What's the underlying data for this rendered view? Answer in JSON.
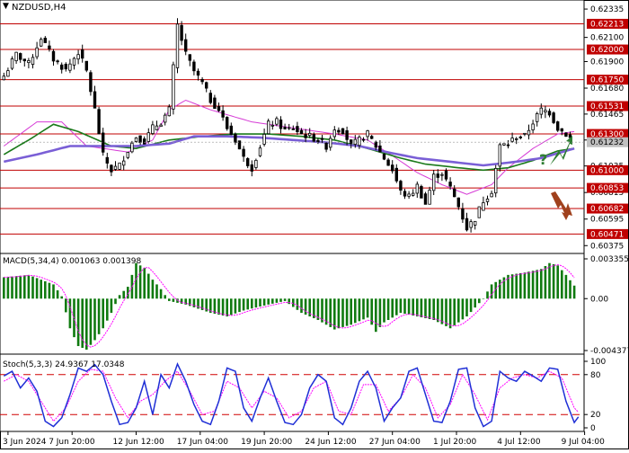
{
  "window": {
    "symbol_timeframe": "NZDUSD,H4",
    "dropdown_glyph": "▼"
  },
  "colors": {
    "candle": "#000000",
    "resistance_line": "#c00000",
    "ma_fast": "#d63bd6",
    "ma_mid": "#1a7a1a",
    "ma_slow": "#7a5fd6",
    "macd_hist": "#0f7a0f",
    "macd_signal": "#ff00ff",
    "stoch_main": "#1f2fd6",
    "stoch_signal": "#ff00ff",
    "stoch_level": "#d00000",
    "current_price_box": "#c0c0c0",
    "up_arrow": "#2e7d32",
    "down_arrow": "#a0411d",
    "question_mark": "#2e7d32"
  },
  "price_axis": {
    "ticks": [
      "0.62335",
      "0.62100",
      "0.61900",
      "0.61680",
      "0.61465",
      "0.61250",
      "0.61035",
      "0.60815",
      "0.60595",
      "0.60375"
    ],
    "levels": [
      {
        "label": "0.62213",
        "value": 0.62213
      },
      {
        "label": "0.62000",
        "value": 0.62
      },
      {
        "label": "0.61750",
        "value": 0.6175
      },
      {
        "label": "0.61531",
        "value": 0.61531
      },
      {
        "label": "0.61300",
        "value": 0.613
      },
      {
        "label": "0.61000",
        "value": 0.61
      },
      {
        "label": "0.60853",
        "value": 0.60853
      },
      {
        "label": "0.60682",
        "value": 0.60682
      },
      {
        "label": "0.60471",
        "value": 0.60471
      }
    ],
    "current_price": "0.61232",
    "range": [
      0.6031,
      0.6241
    ]
  },
  "annotations": {
    "question": "?",
    "up_arrow_icon": "up-arrow-icon",
    "down_arrow_icon": "down-arrow-icon"
  },
  "macd": {
    "label": "MACD(5,34,4) 0.001063 0.001398",
    "ticks": [
      "0.003355",
      "0.00",
      "-0.004377"
    ]
  },
  "stochastic": {
    "label": "Stoch(5,3,3) 24.9367 17.0348",
    "ticks": [
      "100",
      "80",
      "20",
      "0"
    ],
    "levels": [
      80,
      20
    ]
  },
  "time_axis": {
    "labels": [
      "3 Jun 2024",
      "7 Jun 20:00",
      "12 Jun 12:00",
      "17 Jun 04:00",
      "19 Jun 20:00",
      "24 Jun 12:00",
      "27 Jun 04:00",
      "1 Jul 20:00",
      "4 Jul 12:00",
      "9 Jul 04:00"
    ]
  },
  "chart_data": {
    "type": "candlestick",
    "symbol": "NZDUSD",
    "timeframe": "H4",
    "anchors": [
      [
        0,
        0.6178
      ],
      [
        3,
        0.6196
      ],
      [
        6,
        0.6188
      ],
      [
        9,
        0.621
      ],
      [
        12,
        0.6192
      ],
      [
        15,
        0.6183
      ],
      [
        18,
        0.6198
      ],
      [
        20,
        0.6182
      ],
      [
        22,
        0.615
      ],
      [
        24,
        0.6112
      ],
      [
        26,
        0.61
      ],
      [
        28,
        0.6104
      ],
      [
        30,
        0.6117
      ],
      [
        32,
        0.6128
      ],
      [
        34,
        0.6124
      ],
      [
        36,
        0.6135
      ],
      [
        38,
        0.614
      ],
      [
        40,
        0.615
      ],
      [
        42,
        0.622
      ],
      [
        44,
        0.6196
      ],
      [
        46,
        0.6182
      ],
      [
        48,
        0.6172
      ],
      [
        50,
        0.6158
      ],
      [
        52,
        0.615
      ],
      [
        54,
        0.6135
      ],
      [
        56,
        0.6125
      ],
      [
        58,
        0.611
      ],
      [
        60,
        0.6102
      ],
      [
        62,
        0.612
      ],
      [
        64,
        0.6138
      ],
      [
        66,
        0.614
      ],
      [
        68,
        0.6133
      ],
      [
        70,
        0.6135
      ],
      [
        72,
        0.613
      ],
      [
        74,
        0.6128
      ],
      [
        76,
        0.6125
      ],
      [
        78,
        0.612
      ],
      [
        80,
        0.6135
      ],
      [
        82,
        0.6133
      ],
      [
        84,
        0.612
      ],
      [
        86,
        0.6125
      ],
      [
        88,
        0.613
      ],
      [
        90,
        0.612
      ],
      [
        92,
        0.611
      ],
      [
        94,
        0.61
      ],
      [
        96,
        0.6082
      ],
      [
        98,
        0.6078
      ],
      [
        100,
        0.6087
      ],
      [
        102,
        0.6072
      ],
      [
        104,
        0.6095
      ],
      [
        106,
        0.6098
      ],
      [
        108,
        0.6085
      ],
      [
        110,
        0.607
      ],
      [
        112,
        0.6052
      ],
      [
        114,
        0.606
      ],
      [
        116,
        0.6075
      ],
      [
        118,
        0.6083
      ],
      [
        120,
        0.612
      ],
      [
        122,
        0.6122
      ],
      [
        124,
        0.6128
      ],
      [
        126,
        0.6128
      ],
      [
        128,
        0.614
      ],
      [
        130,
        0.615
      ],
      [
        132,
        0.6148
      ],
      [
        134,
        0.6135
      ],
      [
        136,
        0.613
      ],
      [
        138,
        0.6123
      ]
    ],
    "last_close": 0.61232,
    "resistance_levels": [
      0.62213,
      0.62,
      0.6175,
      0.61531,
      0.613
    ],
    "support_levels": [
      0.61,
      0.60853,
      0.60682,
      0.60471
    ],
    "moving_averages": [
      {
        "anchors": [
          [
            0,
            0.612
          ],
          [
            8,
            0.614
          ],
          [
            14,
            0.614
          ],
          [
            20,
            0.612
          ],
          [
            30,
            0.6115
          ],
          [
            36,
            0.6125
          ],
          [
            40,
            0.615
          ],
          [
            44,
            0.6158
          ],
          [
            50,
            0.615
          ],
          [
            60,
            0.614
          ],
          [
            70,
            0.6135
          ],
          [
            80,
            0.613
          ],
          [
            88,
            0.6125
          ],
          [
            94,
            0.6112
          ],
          [
            100,
            0.6098
          ],
          [
            106,
            0.6088
          ],
          [
            112,
            0.608
          ],
          [
            118,
            0.6088
          ],
          [
            122,
            0.6102
          ],
          [
            128,
            0.6118
          ],
          [
            134,
            0.613
          ],
          [
            138,
            0.6132
          ]
        ]
      },
      {
        "anchors": [
          [
            0,
            0.6113
          ],
          [
            6,
            0.6125
          ],
          [
            12,
            0.6138
          ],
          [
            18,
            0.6132
          ],
          [
            26,
            0.612
          ],
          [
            32,
            0.6118
          ],
          [
            40,
            0.6125
          ],
          [
            48,
            0.6128
          ],
          [
            56,
            0.613
          ],
          [
            64,
            0.613
          ],
          [
            72,
            0.6128
          ],
          [
            80,
            0.6125
          ],
          [
            88,
            0.6118
          ],
          [
            96,
            0.611
          ],
          [
            102,
            0.6105
          ],
          [
            110,
            0.6102
          ],
          [
            116,
            0.61
          ],
          [
            122,
            0.6102
          ],
          [
            128,
            0.6108
          ],
          [
            134,
            0.6116
          ],
          [
            138,
            0.6118
          ]
        ]
      },
      {
        "anchors": [
          [
            0,
            0.6107
          ],
          [
            8,
            0.6113
          ],
          [
            16,
            0.612
          ],
          [
            24,
            0.612
          ],
          [
            32,
            0.612
          ],
          [
            40,
            0.6122
          ],
          [
            46,
            0.6128
          ],
          [
            54,
            0.6128
          ],
          [
            62,
            0.6127
          ],
          [
            70,
            0.6125
          ],
          [
            78,
            0.6123
          ],
          [
            86,
            0.612
          ],
          [
            94,
            0.6114
          ],
          [
            100,
            0.611
          ],
          [
            108,
            0.6107
          ],
          [
            116,
            0.6104
          ],
          [
            124,
            0.6107
          ],
          [
            130,
            0.611
          ],
          [
            138,
            0.6118
          ]
        ]
      }
    ],
    "macd": {
      "range": [
        -0.004377,
        0.003355
      ],
      "anchors": [
        [
          0,
          0.0018
        ],
        [
          6,
          0.002
        ],
        [
          12,
          0.0012
        ],
        [
          14,
          0.0002
        ],
        [
          16,
          -0.0025
        ],
        [
          18,
          -0.004
        ],
        [
          20,
          -0.0043
        ],
        [
          22,
          -0.0035
        ],
        [
          24,
          -0.0025
        ],
        [
          26,
          -0.0012
        ],
        [
          28,
          0.0003
        ],
        [
          30,
          0.001
        ],
        [
          32,
          0.003
        ],
        [
          34,
          0.0026
        ],
        [
          36,
          0.0016
        ],
        [
          38,
          0.0008
        ],
        [
          40,
          -0.0002
        ],
        [
          44,
          -0.0005
        ],
        [
          50,
          -0.0012
        ],
        [
          54,
          -0.0015
        ],
        [
          58,
          -0.001
        ],
        [
          64,
          -0.0005
        ],
        [
          68,
          -0.0002
        ],
        [
          72,
          -0.0012
        ],
        [
          76,
          -0.0018
        ],
        [
          80,
          -0.0026
        ],
        [
          84,
          -0.0022
        ],
        [
          88,
          -0.0016
        ],
        [
          90,
          -0.0028
        ],
        [
          92,
          -0.002
        ],
        [
          96,
          -0.0012
        ],
        [
          100,
          -0.0015
        ],
        [
          104,
          -0.0018
        ],
        [
          108,
          -0.0025
        ],
        [
          112,
          -0.0015
        ],
        [
          116,
          0.0
        ],
        [
          118,
          0.0012
        ],
        [
          122,
          0.002
        ],
        [
          126,
          0.0022
        ],
        [
          130,
          0.0025
        ],
        [
          132,
          0.003
        ],
        [
          134,
          0.0028
        ],
        [
          136,
          0.002
        ],
        [
          138,
          0.0011
        ]
      ]
    },
    "stochastic": {
      "main_anchors": [
        [
          0,
          78
        ],
        [
          2,
          85
        ],
        [
          4,
          60
        ],
        [
          6,
          75
        ],
        [
          8,
          55
        ],
        [
          10,
          10
        ],
        [
          12,
          2
        ],
        [
          14,
          15
        ],
        [
          16,
          50
        ],
        [
          18,
          90
        ],
        [
          20,
          85
        ],
        [
          22,
          95
        ],
        [
          24,
          80
        ],
        [
          26,
          40
        ],
        [
          28,
          5
        ],
        [
          30,
          8
        ],
        [
          32,
          30
        ],
        [
          34,
          70
        ],
        [
          36,
          20
        ],
        [
          38,
          80
        ],
        [
          40,
          60
        ],
        [
          42,
          96
        ],
        [
          44,
          70
        ],
        [
          46,
          35
        ],
        [
          48,
          10
        ],
        [
          50,
          5
        ],
        [
          52,
          40
        ],
        [
          54,
          90
        ],
        [
          56,
          85
        ],
        [
          58,
          30
        ],
        [
          60,
          10
        ],
        [
          62,
          45
        ],
        [
          64,
          75
        ],
        [
          66,
          40
        ],
        [
          68,
          8
        ],
        [
          70,
          5
        ],
        [
          72,
          20
        ],
        [
          74,
          60
        ],
        [
          76,
          80
        ],
        [
          78,
          70
        ],
        [
          80,
          15
        ],
        [
          82,
          5
        ],
        [
          84,
          30
        ],
        [
          86,
          70
        ],
        [
          88,
          85
        ],
        [
          90,
          60
        ],
        [
          92,
          10
        ],
        [
          94,
          30
        ],
        [
          96,
          45
        ],
        [
          98,
          85
        ],
        [
          100,
          90
        ],
        [
          102,
          50
        ],
        [
          104,
          10
        ],
        [
          106,
          8
        ],
        [
          108,
          40
        ],
        [
          110,
          88
        ],
        [
          112,
          90
        ],
        [
          114,
          30
        ],
        [
          116,
          2
        ],
        [
          118,
          10
        ],
        [
          120,
          85
        ],
        [
          122,
          75
        ],
        [
          124,
          70
        ],
        [
          126,
          85
        ],
        [
          128,
          78
        ],
        [
          130,
          70
        ],
        [
          132,
          90
        ],
        [
          134,
          88
        ],
        [
          136,
          40
        ],
        [
          138,
          8
        ],
        [
          140,
          25
        ]
      ],
      "signal_anchors": [
        [
          0,
          70
        ],
        [
          3,
          80
        ],
        [
          6,
          70
        ],
        [
          9,
          40
        ],
        [
          12,
          10
        ],
        [
          15,
          30
        ],
        [
          18,
          70
        ],
        [
          21,
          88
        ],
        [
          24,
          85
        ],
        [
          27,
          45
        ],
        [
          30,
          15
        ],
        [
          33,
          40
        ],
        [
          36,
          50
        ],
        [
          39,
          70
        ],
        [
          42,
          85
        ],
        [
          45,
          55
        ],
        [
          48,
          20
        ],
        [
          51,
          25
        ],
        [
          54,
          70
        ],
        [
          57,
          60
        ],
        [
          60,
          30
        ],
        [
          63,
          55
        ],
        [
          66,
          45
        ],
        [
          69,
          15
        ],
        [
          72,
          25
        ],
        [
          75,
          60
        ],
        [
          78,
          70
        ],
        [
          81,
          25
        ],
        [
          84,
          20
        ],
        [
          87,
          65
        ],
        [
          90,
          65
        ],
        [
          93,
          25
        ],
        [
          96,
          45
        ],
        [
          99,
          80
        ],
        [
          102,
          60
        ],
        [
          105,
          15
        ],
        [
          108,
          35
        ],
        [
          111,
          80
        ],
        [
          114,
          50
        ],
        [
          117,
          12
        ],
        [
          120,
          60
        ],
        [
          123,
          75
        ],
        [
          126,
          80
        ],
        [
          129,
          75
        ],
        [
          132,
          85
        ],
        [
          135,
          75
        ],
        [
          138,
          30
        ],
        [
          140,
          17
        ]
      ]
    }
  }
}
